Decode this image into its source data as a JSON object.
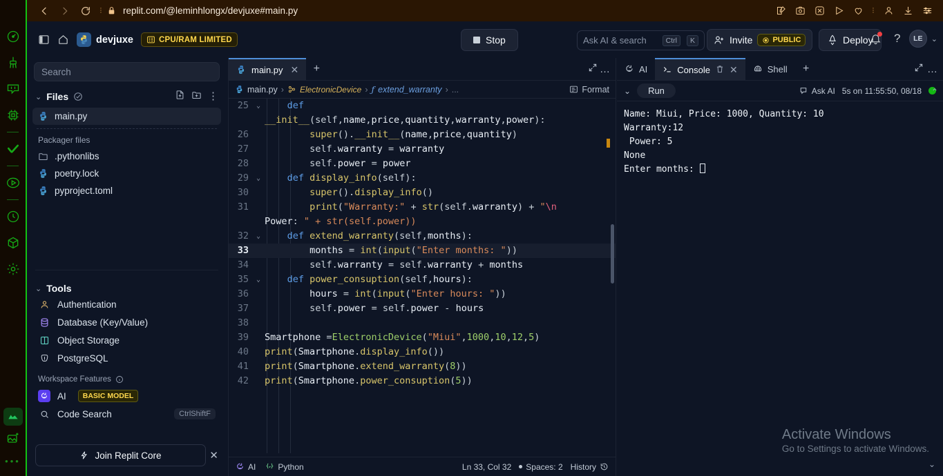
{
  "browser": {
    "url": "replit.com/@leminhlongx/devjuxe#main.py",
    "back_icon": "chevron-left-icon",
    "forward_icon": "chevron-right-icon",
    "reload_icon": "reload-icon",
    "lock_icon": "lock-icon",
    "right_icons": [
      "edit-bookmark-icon",
      "screenshot-icon",
      "extension-blocked-icon",
      "send-icon",
      "heart-icon",
      "profile-icon",
      "download-icon",
      "settings-sliders-icon"
    ]
  },
  "header": {
    "sidebar_toggle_icon": "panel-toggle-icon",
    "home_icon": "home-icon",
    "project_name": "devjuxe",
    "cpu_badge": "CPU/RAM LIMITED",
    "stop_label": "Stop",
    "ask_ai_placeholder": "Ask AI & search",
    "kbd_ctrl": "Ctrl",
    "kbd_k": "K",
    "invite_label": "Invite",
    "public_label": "PUBLIC",
    "deploy_label": "Deploy",
    "avatar_initials": "LE"
  },
  "sidebar": {
    "search_placeholder": "Search",
    "files_title": "Files",
    "files": [
      {
        "name": "main.py",
        "icon": "python-icon",
        "selected": true
      }
    ],
    "packager_label": "Packager files",
    "packager_files": [
      {
        "name": ".pythonlibs",
        "icon": "folder-icon"
      },
      {
        "name": "poetry.lock",
        "icon": "python-icon"
      },
      {
        "name": "pyproject.toml",
        "icon": "python-icon"
      }
    ],
    "tools_title": "Tools",
    "tools": [
      {
        "name": "Authentication",
        "icon": "user-icon"
      },
      {
        "name": "Database (Key/Value)",
        "icon": "database-icon"
      },
      {
        "name": "Object Storage",
        "icon": "storage-icon"
      },
      {
        "name": "PostgreSQL",
        "icon": "postgres-icon"
      }
    ],
    "workspace_features_label": "Workspace Features",
    "features": [
      {
        "name": "AI",
        "icon": "replit-ai-icon",
        "badge": "BASIC MODEL",
        "shortcut": ""
      },
      {
        "name": "Code Search",
        "icon": "search-icon",
        "badge": "",
        "shortcut": "CtrlShiftF"
      }
    ],
    "join_core_label": "Join Replit Core"
  },
  "editor": {
    "tab_name": "main.py",
    "breadcrumb": {
      "file": "main.py",
      "class": "ElectronicDevice",
      "function": "extend_warranty",
      "ellipsis": "..."
    },
    "format_label": "Format",
    "lines": [
      {
        "num": "25",
        "fold": true,
        "text": "    def"
      },
      {
        "num": "",
        "fold": false,
        "text": "__init__(self,name,price,quantity,warranty,power):"
      },
      {
        "num": "26",
        "fold": false,
        "text": "        super().__init__(name,price,quantity)"
      },
      {
        "num": "27",
        "fold": false,
        "text": "        self.warranty = warranty"
      },
      {
        "num": "28",
        "fold": false,
        "text": "        self.power = power"
      },
      {
        "num": "29",
        "fold": true,
        "text": "    def display_info(self):"
      },
      {
        "num": "30",
        "fold": false,
        "text": "        super().display_info()"
      },
      {
        "num": "31",
        "fold": false,
        "text": "        print(\"Warranty:\" + str(self.warranty) + \"\\n"
      },
      {
        "num": "",
        "fold": false,
        "text": "Power: \" + str(self.power))"
      },
      {
        "num": "32",
        "fold": true,
        "text": "    def extend_warranty(self,months):"
      },
      {
        "num": "33",
        "fold": false,
        "text": "        months = int(input(\"Enter months: \"))",
        "highlight": true
      },
      {
        "num": "34",
        "fold": false,
        "text": "        self.warranty = self.warranty + months"
      },
      {
        "num": "35",
        "fold": true,
        "text": "    def power_consuption(self,hours):"
      },
      {
        "num": "36",
        "fold": false,
        "text": "        hours = int(input(\"Enter hours: \"))"
      },
      {
        "num": "37",
        "fold": false,
        "text": "        self.power = self.power - hours"
      },
      {
        "num": "38",
        "fold": false,
        "text": ""
      },
      {
        "num": "39",
        "fold": false,
        "text": "Smartphone =ElectronicDevice(\"Miui\",1000,10,12,5)"
      },
      {
        "num": "40",
        "fold": false,
        "text": "print(Smartphone.display_info())"
      },
      {
        "num": "41",
        "fold": false,
        "text": "print(Smartphone.extend_warranty(8))"
      },
      {
        "num": "42",
        "fold": false,
        "text": "print(Smartphone.power_consuption(5))"
      }
    ],
    "status": {
      "ai_label": "AI",
      "language": "Python",
      "cursor": "Ln 33, Col 32",
      "spaces": "Spaces: 2",
      "history": "History"
    }
  },
  "right_panel": {
    "tabs": [
      {
        "label": "AI",
        "icon": "replit-ai-icon",
        "active": false,
        "closable": false
      },
      {
        "label": "Console",
        "icon": "console-icon",
        "active": true,
        "closable": true
      },
      {
        "label": "Shell",
        "icon": "shell-icon",
        "active": false,
        "closable": false
      }
    ],
    "run_label": "Run",
    "ask_ai_label": "Ask AI",
    "run_status": "5s on 11:55:50, 08/18",
    "console_output": "Name: Miui, Price: 1000, Quantity: 10\nWarranty:12\n Power: 5\nNone\nEnter months: "
  },
  "watermark": {
    "title": "Activate Windows",
    "subtitle": "Go to Settings to activate Windows."
  },
  "colors": {
    "bg": "#0e1525",
    "panel": "#1c2333",
    "accent_blue": "#4f8fd9",
    "yellow": "#ffd84d",
    "green": "#14b814",
    "browser_bg": "#2a1603",
    "rail_green": "#12c312"
  }
}
